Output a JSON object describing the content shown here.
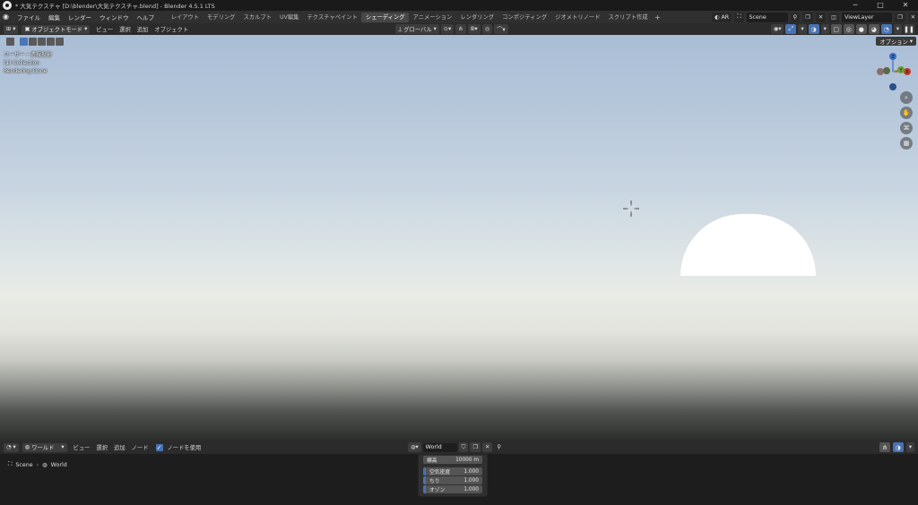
{
  "titlebar": {
    "title": "* 大気テクスチャ [D:\\blender\\大気テクスチャ.blend] - Blender 4.5.1 LTS",
    "minimize": "─",
    "maximize": "□",
    "close": "✕"
  },
  "topbar": {
    "menus": [
      "ファイル",
      "編集",
      "レンダー",
      "ウィンドウ",
      "ヘルプ"
    ],
    "workspaces": [
      "レイアウト",
      "モデリング",
      "スカルプト",
      "UV編集",
      "テクスチャペイント",
      "シェーディング",
      "アニメーション",
      "レンダリング",
      "コンポジティング",
      "ジオメトリノード",
      "スクリプト作成"
    ],
    "active_workspace": "シェーディング",
    "add_workspace": "+",
    "ar_label": "AR",
    "scene_name": "Scene",
    "viewlayer_name": "ViewLayer"
  },
  "viewport_header": {
    "mode": "オブジェクトモード",
    "menus": [
      "ビュー",
      "選択",
      "追加",
      "オブジェクト"
    ],
    "transform_orientation": "グローバル"
  },
  "viewport": {
    "info_lines": [
      "ユーザー・透視投影",
      "(1) Collection",
      "Rendering Done"
    ],
    "options_label": "オプション",
    "gizmo": {
      "z_label": "Z",
      "x_label": "X",
      "y_label": "Y"
    }
  },
  "shader_header": {
    "context": "ワールド",
    "menus": [
      "ビュー",
      "選択",
      "追加",
      "ノード"
    ],
    "use_nodes_label": "ノードを使用",
    "use_nodes_checked": true,
    "world_name": "World"
  },
  "breadcrumb": [
    "Scene",
    "World"
  ],
  "node": {
    "altitude_label": "標高",
    "altitude_value": "10000 m",
    "air_label": "空気密度",
    "air_value": "1.000",
    "dust_label": "ちり",
    "dust_value": "1.000",
    "ozone_label": "オゾン",
    "ozone_value": "1.000"
  },
  "colors": {
    "accent_blue": "#4772b3",
    "sun": "#ffffff",
    "gizmo_x": "#c0392b",
    "gizmo_y": "#6f9f3b",
    "gizmo_z": "#3b6fc4"
  }
}
